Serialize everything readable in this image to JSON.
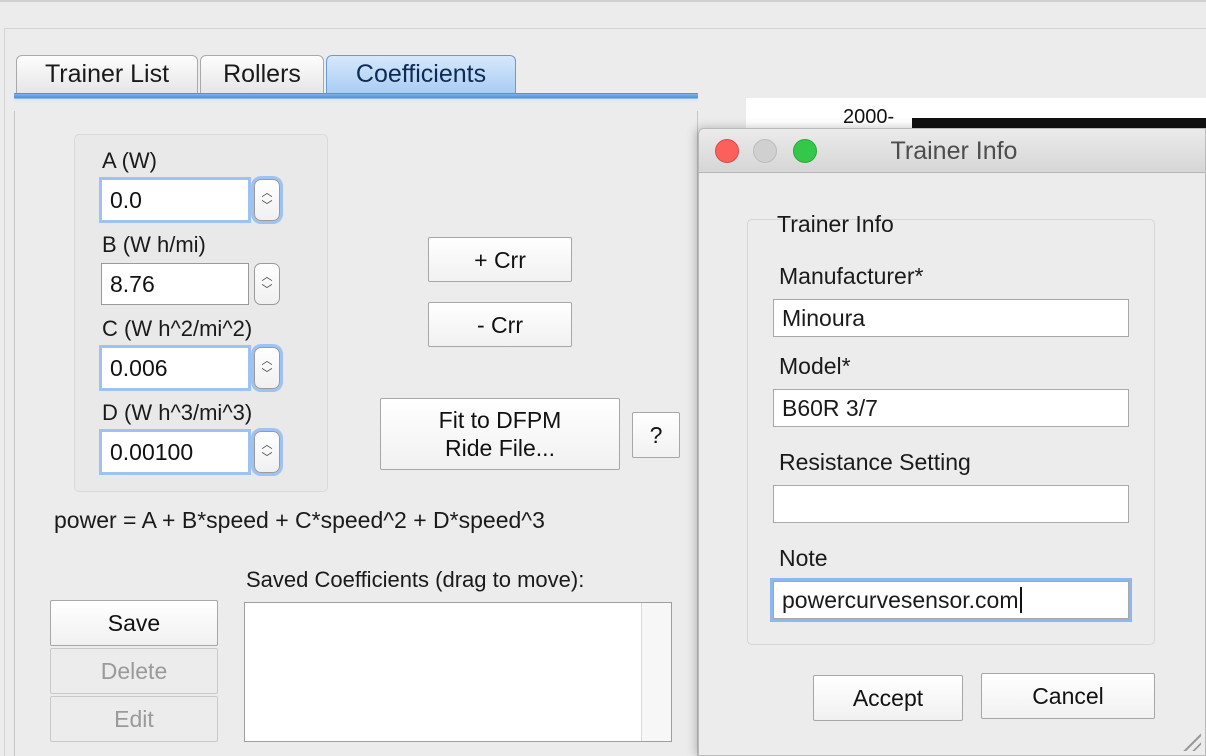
{
  "tabs": [
    "Trainer List",
    "Rollers",
    "Coefficients"
  ],
  "coefficients": {
    "fields": [
      {
        "label": "A (W)",
        "value": "0.0"
      },
      {
        "label": "B (W h/mi)",
        "value": "8.76"
      },
      {
        "label": "C (W h^2/mi^2)",
        "value": "0.006"
      },
      {
        "label": "D (W h^3/mi^3)",
        "value": "0.00100"
      }
    ],
    "plus_crr": "+ Crr",
    "minus_crr": "- Crr",
    "fit_line1": "Fit to DFPM",
    "fit_line2": "Ride File...",
    "help": "?",
    "formula": "power = A + B*speed + C*speed^2 + D*speed^3",
    "saved_label": "Saved Coefficients (drag to move):",
    "save": "Save",
    "delete": "Delete",
    "edit": "Edit"
  },
  "chart": {
    "tick_label": "2000-"
  },
  "dialog": {
    "title": "Trainer Info",
    "group_title": "Trainer Info",
    "manufacturer_label": "Manufacturer*",
    "manufacturer_value": "Minoura",
    "model_label": "Model*",
    "model_value": "B60R 3/7",
    "resistance_label": "Resistance Setting",
    "resistance_value": "",
    "note_label": "Note",
    "note_value": "powercurvesensor.com",
    "accept": "Accept",
    "cancel": "Cancel"
  },
  "colors": {
    "close": "#fc605c",
    "minimize_inactive": "#d0d0d0",
    "zoom": "#34c84a",
    "active_tab": "#a9cdf3"
  }
}
